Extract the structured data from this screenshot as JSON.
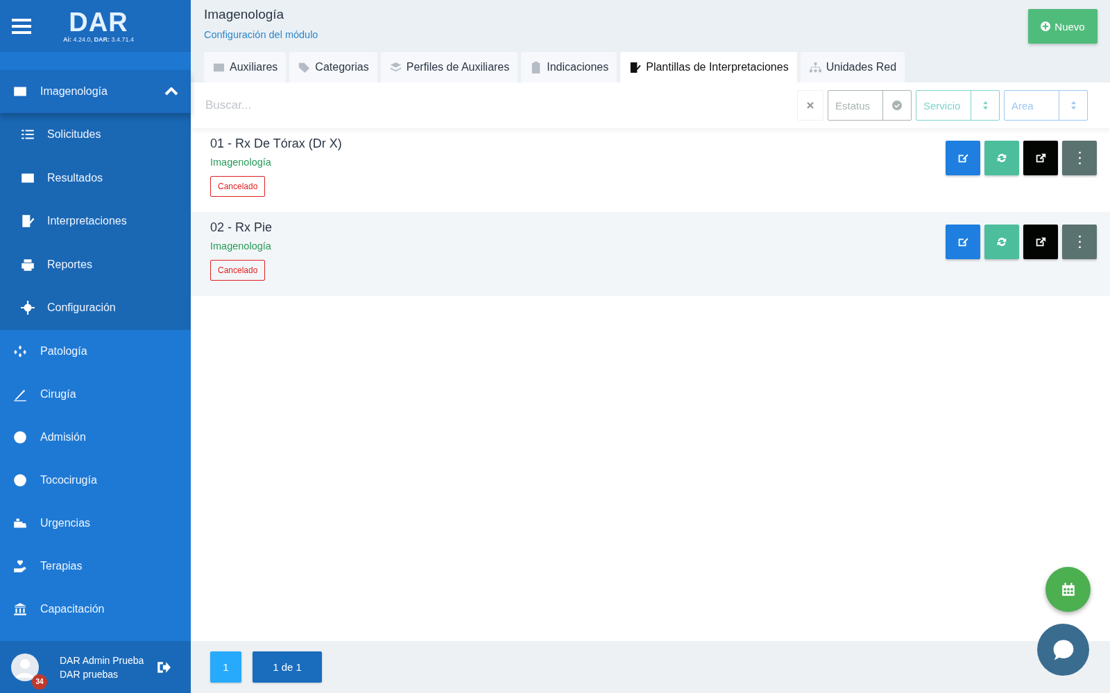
{
  "sidebar": {
    "logo": "DAR",
    "version": "**Ai:** 4.24.0, **DAR:** 3.4.71.4",
    "items": [
      {
        "label": "Imagenología",
        "selected": true,
        "expanded": true,
        "children": [
          {
            "label": "Solicitudes"
          },
          {
            "label": "Resultados"
          },
          {
            "label": "Interpretaciones"
          },
          {
            "label": "Reportes"
          },
          {
            "label": "Configuración"
          }
        ]
      },
      {
        "label": "Patología",
        "selected": false
      },
      {
        "label": "Cirugía",
        "selected": false
      },
      {
        "label": "Admisión",
        "selected": false
      },
      {
        "label": "Tococirugía",
        "selected": false
      },
      {
        "label": "Urgencias",
        "selected": false
      },
      {
        "label": "Terapias",
        "selected": false
      },
      {
        "label": "Capacitación",
        "selected": false
      }
    ],
    "user": {
      "name": "DAR Admin Prueba",
      "role": "DAR pruebas",
      "badge": "34"
    }
  },
  "header": {
    "title": "Imagenología",
    "subtitle": "Configuración del módulo",
    "new_button": "Nuevo"
  },
  "tabs": [
    {
      "label": "Auxiliares",
      "selected": false
    },
    {
      "label": "Categorias",
      "selected": false
    },
    {
      "label": "Perfiles de Auxiliares",
      "selected": false
    },
    {
      "label": "Indicaciones",
      "selected": false
    },
    {
      "label": "Plantillas de Interpretaciones",
      "selected": true
    },
    {
      "label": "Unidades Red",
      "selected": false
    }
  ],
  "search": {
    "placeholder": "Buscar..."
  },
  "filters": [
    {
      "label": "Estatus",
      "color": "#a9b3b3"
    },
    {
      "label": "Servicio",
      "color": "#7fd3cf"
    },
    {
      "label": "Area",
      "color": "#9cc8f5"
    }
  ],
  "rows": [
    {
      "title": "01 - Rx De Tórax (Dr X)",
      "category": "Imagenología",
      "status": "Cancelado"
    },
    {
      "title": "02 - Rx Pie",
      "category": "Imagenología",
      "status": "Cancelado"
    }
  ],
  "pagination": {
    "pages": [
      {
        "label": "1",
        "selected": true
      }
    ],
    "summary": "1 de 1"
  }
}
